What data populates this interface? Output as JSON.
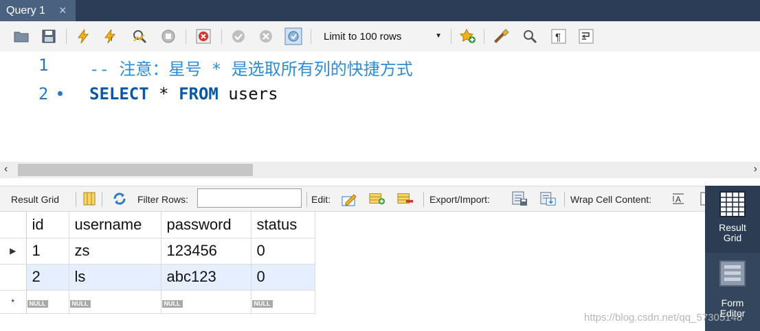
{
  "tab": {
    "title": "Query 1",
    "close": "×"
  },
  "toolbar": {
    "limit_label": "Limit to 100 rows",
    "icons": [
      "folder-icon",
      "save-icon",
      "execute-icon",
      "execute-current-icon",
      "explain-icon",
      "stop-icon",
      "toggle-error-icon",
      "commit-icon",
      "rollback-icon",
      "autocommit-icon",
      "beautify-icon",
      "find-icon",
      "invisible-chars-icon",
      "wrap-icon"
    ]
  },
  "editor": {
    "lines": [
      {
        "num": "1",
        "text": "-- 注意：星号 * 是选取所有列的快捷方式"
      },
      {
        "num": "2",
        "kw1": "SELECT",
        "star": " * ",
        "kw2": "FROM",
        "rest": " users"
      }
    ]
  },
  "result_toolbar": {
    "result_grid": "Result Grid",
    "filter_rows": "Filter Rows:",
    "filter_value": "",
    "edit": "Edit:",
    "export_import": "Export/Import:",
    "wrap_cell": "Wrap Cell Content:"
  },
  "grid": {
    "columns": [
      "id",
      "username",
      "password",
      "status"
    ],
    "rows": [
      [
        "1",
        "zs",
        "123456",
        "0"
      ],
      [
        "2",
        "ls",
        "abc123",
        "0"
      ]
    ],
    "null_label": "NULL",
    "new_row_marker": "*"
  },
  "side_panel": {
    "result_grid_line1": "Result",
    "result_grid_line2": "Grid",
    "form_editor_line1": "Form",
    "form_editor_line2": "Editor"
  },
  "watermark": "https://blog.csdn.net/qq_57305148",
  "colors": {
    "tab_bar": "#2c3e57",
    "keyword": "#0b57a4",
    "comment": "#2f8cd6",
    "side_panel": "#34465e",
    "selected_row": "#e5efff"
  }
}
